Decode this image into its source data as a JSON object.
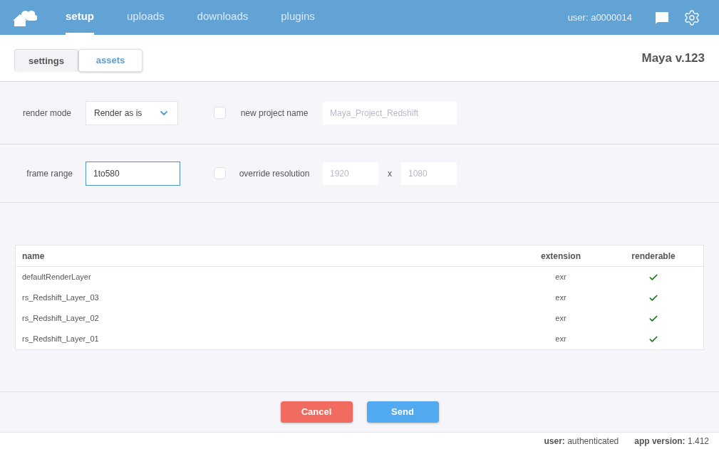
{
  "nav": [
    {
      "label": "setup",
      "selected": true
    },
    {
      "label": "uploads",
      "selected": false
    },
    {
      "label": "downloads",
      "selected": false
    },
    {
      "label": "plugins",
      "selected": false
    }
  ],
  "user": "user: a0000014",
  "tabs": [
    {
      "label": "settings",
      "selected": true
    },
    {
      "label": "assets",
      "selected": false
    }
  ],
  "app_title": "Maya v.123",
  "render_mode": {
    "label": "render mode",
    "value": "Render as is"
  },
  "new_project": {
    "label": "new project name",
    "checked": false,
    "placeholder": "Maya_Project_Redshift"
  },
  "frame_range": {
    "label": "frame range",
    "value": "1to580"
  },
  "override_resolution": {
    "label": "override resolution",
    "checked": false,
    "width_placeholder": "1920",
    "separator": "x",
    "height_placeholder": "1080"
  },
  "table": {
    "columns": [
      "name",
      "extension",
      "renderable"
    ],
    "rows": [
      {
        "name": "defaultRenderLayer",
        "extension": "exr",
        "renderable": true
      },
      {
        "name": "rs_Redshift_Layer_03",
        "extension": "exr",
        "renderable": true
      },
      {
        "name": "rs_Redshift_Layer_02",
        "extension": "exr",
        "renderable": true
      },
      {
        "name": "rs_Redshift_Layer_01",
        "extension": "exr",
        "renderable": true
      }
    ]
  },
  "buttons": {
    "cancel": "Cancel",
    "send": "Send"
  },
  "status_bar": [
    "**user:** authenticated",
    "**app version:** 1.412"
  ]
}
